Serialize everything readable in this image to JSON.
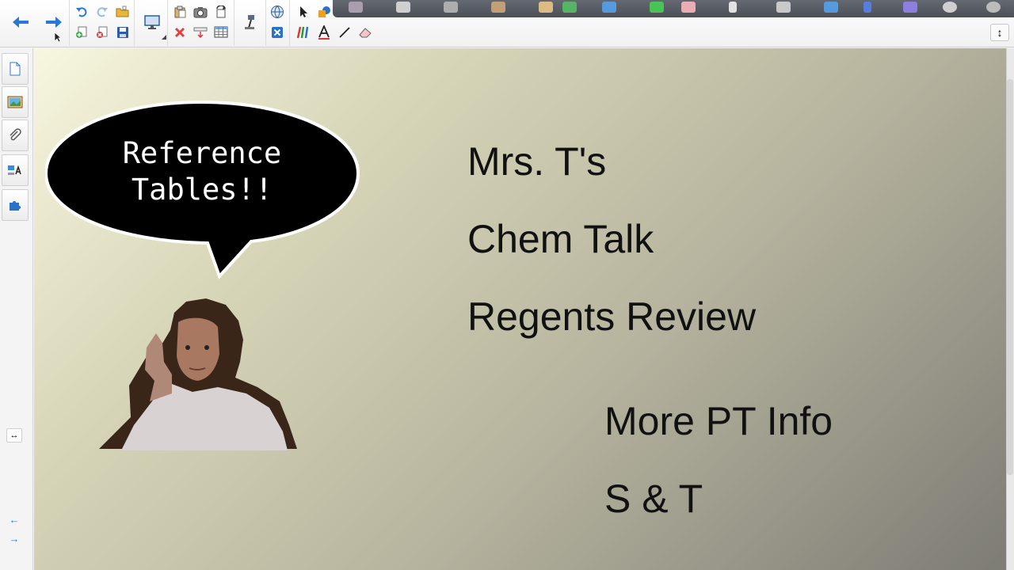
{
  "toolbar": {
    "groups": [
      "navigation",
      "page-edit",
      "display",
      "tools"
    ],
    "tray_apps": [
      "pen",
      "highlighter",
      "shapes",
      "eraser",
      "select",
      "fill",
      "text",
      "line"
    ],
    "resize_glyph": "↕"
  },
  "sidebar": {
    "tabs": [
      "page-sorter",
      "gallery",
      "attachments",
      "properties",
      "add-ons"
    ],
    "collapse_glyph": "↔",
    "prev_glyph": "←",
    "next_glyph": "→"
  },
  "slide": {
    "bubble_line1": "Reference",
    "bubble_line2": "Tables!!",
    "line1": "Mrs. T's",
    "line2": "Chem Talk",
    "line3": "Regents Review",
    "line4": "More PT Info",
    "line5": "S & T"
  },
  "colors": {
    "nav_arrow": "#2a78d6",
    "undo": "#2a78d6",
    "delete": "#e04040",
    "bubble_fill": "#000000",
    "slide_text": "#111111"
  }
}
